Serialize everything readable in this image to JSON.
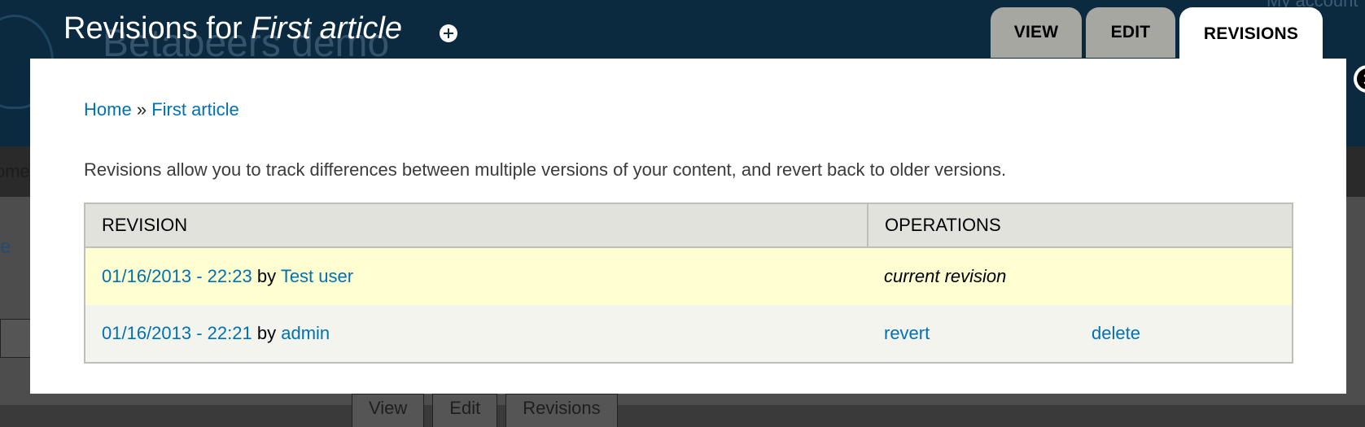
{
  "background": {
    "site_name": "Betabeers demo",
    "account_link": "My account",
    "nav_fragment": "ome",
    "content_link_fragment": "e",
    "tabs": [
      "View",
      "Edit",
      "Revisions"
    ]
  },
  "overlay": {
    "title_prefix": "Revisions for ",
    "title_node": "First article",
    "tabs": [
      "VIEW",
      "EDIT",
      "REVISIONS"
    ],
    "active_tab": "REVISIONS"
  },
  "breadcrumb": {
    "home": "Home",
    "separator": "»",
    "current": "First article"
  },
  "help_text": "Revisions allow you to track differences between multiple versions of your content, and revert back to older versions.",
  "table": {
    "headers": [
      "REVISION",
      "OPERATIONS"
    ],
    "rows": [
      {
        "date": "01/16/2013 - 22:23",
        "by": "by",
        "author": "Test user",
        "status": "current revision"
      },
      {
        "date": "01/16/2013 - 22:21",
        "by": "by",
        "author": "admin",
        "revert": "revert",
        "delete": "delete"
      }
    ]
  },
  "colors": {
    "header_bg": "#0b2a40",
    "link": "#0071b3",
    "tab_inactive": "#a7a7a2",
    "current_row": "#ffffd2",
    "old_row": "#f3f4ee"
  }
}
